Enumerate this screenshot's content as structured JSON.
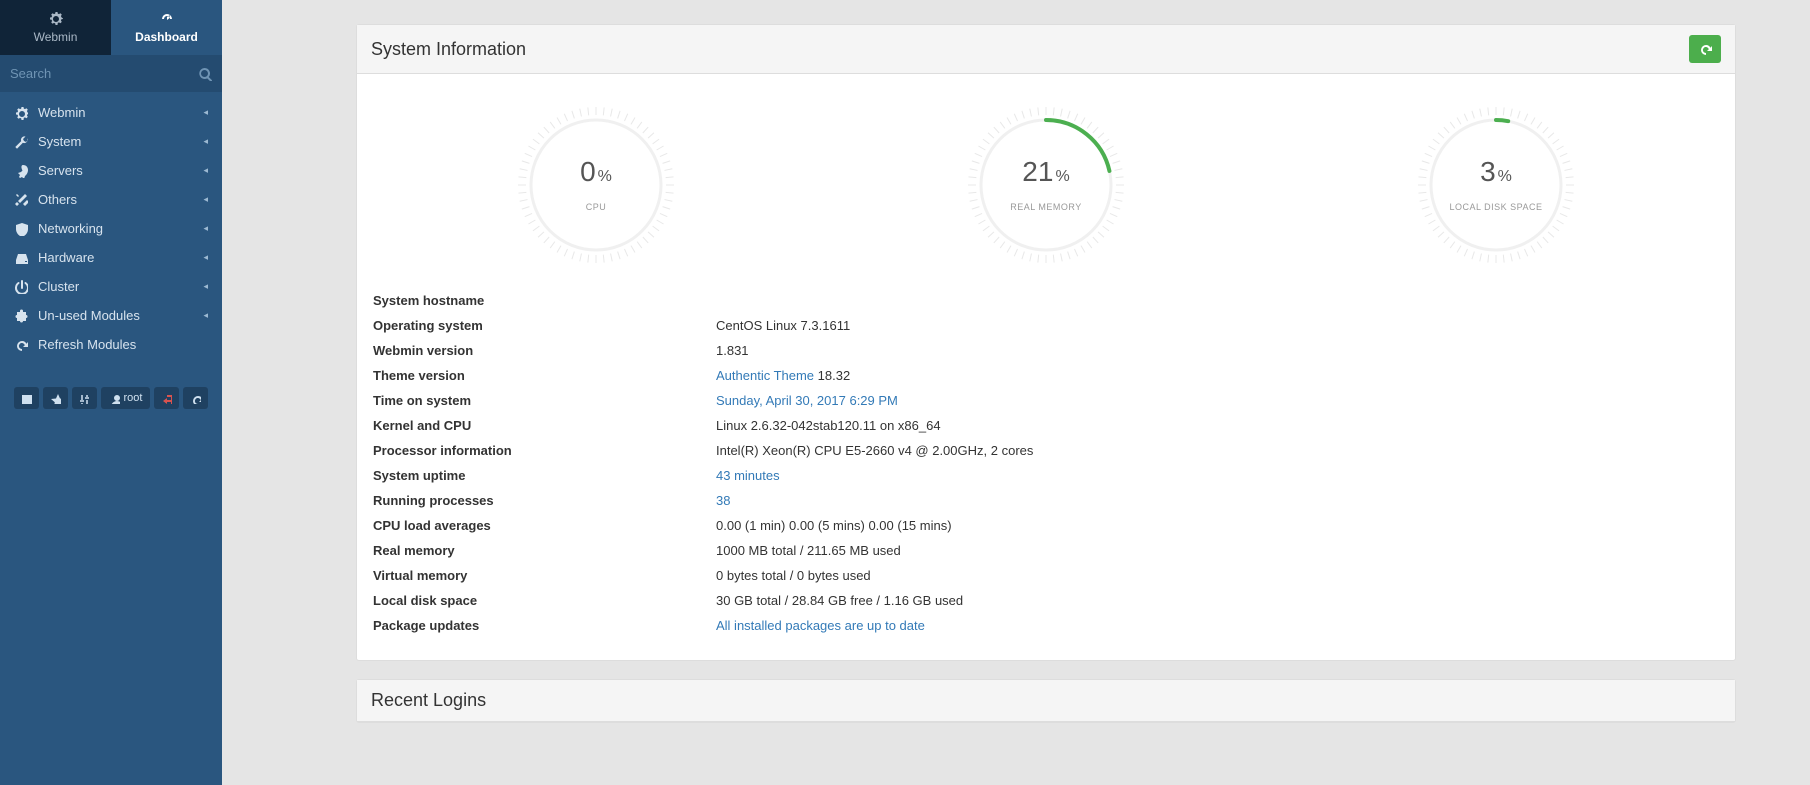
{
  "chart_data": [
    {
      "type": "gauge",
      "label": "CPU",
      "value": 0,
      "max": 100
    },
    {
      "type": "gauge",
      "label": "REAL MEMORY",
      "value": 21,
      "max": 100
    },
    {
      "type": "gauge",
      "label": "LOCAL DISK SPACE",
      "value": 3,
      "max": 100
    }
  ],
  "tabs": {
    "webmin": "Webmin",
    "dashboard": "Dashboard"
  },
  "search": {
    "placeholder": "Search"
  },
  "nav": [
    {
      "label": "Webmin",
      "icon": "gear"
    },
    {
      "label": "System",
      "icon": "wrench"
    },
    {
      "label": "Servers",
      "icon": "rocket"
    },
    {
      "label": "Others",
      "icon": "tools"
    },
    {
      "label": "Networking",
      "icon": "shield"
    },
    {
      "label": "Hardware",
      "icon": "hdd"
    },
    {
      "label": "Cluster",
      "icon": "power"
    },
    {
      "label": "Un-used Modules",
      "icon": "puzzle"
    }
  ],
  "nav_refresh": "Refresh Modules",
  "user_label": "root",
  "panels": {
    "sysinfo_title": "System Information",
    "recent_title": "Recent Logins"
  },
  "gauges": {
    "cpu": {
      "value": "0",
      "label": "CPU"
    },
    "mem": {
      "value": "21",
      "label": "REAL MEMORY"
    },
    "disk": {
      "value": "3",
      "label": "LOCAL DISK SPACE"
    }
  },
  "info": {
    "hostname_k": "System hostname",
    "hostname_v": "",
    "os_k": "Operating system",
    "os_v": "CentOS Linux 7.3.1611",
    "wm_k": "Webmin version",
    "wm_v": "1.831",
    "theme_k": "Theme version",
    "theme_link": "Authentic Theme",
    "theme_ver": " 18.32",
    "time_k": "Time on system",
    "time_v": "Sunday, April 30, 2017 6:29 PM",
    "kernel_k": "Kernel and CPU",
    "kernel_v": "Linux 2.6.32-042stab120.11 on x86_64",
    "proc_k": "Processor information",
    "proc_v": "Intel(R) Xeon(R) CPU E5-2660 v4 @ 2.00GHz, 2 cores",
    "uptime_k": "System uptime",
    "uptime_v": "43 minutes",
    "running_k": "Running processes",
    "running_v": "38",
    "load_k": "CPU load averages",
    "load_v": "0.00 (1 min) 0.00 (5 mins) 0.00 (15 mins)",
    "realmem_k": "Real memory",
    "realmem_v": "1000 MB total / 211.65 MB used",
    "virtmem_k": "Virtual memory",
    "virtmem_v": "0 bytes total / 0 bytes used",
    "disk_k": "Local disk space",
    "disk_v": "30 GB total / 28.84 GB free / 1.16 GB used",
    "pkg_k": "Package updates",
    "pkg_v": "All installed packages are up to date"
  }
}
